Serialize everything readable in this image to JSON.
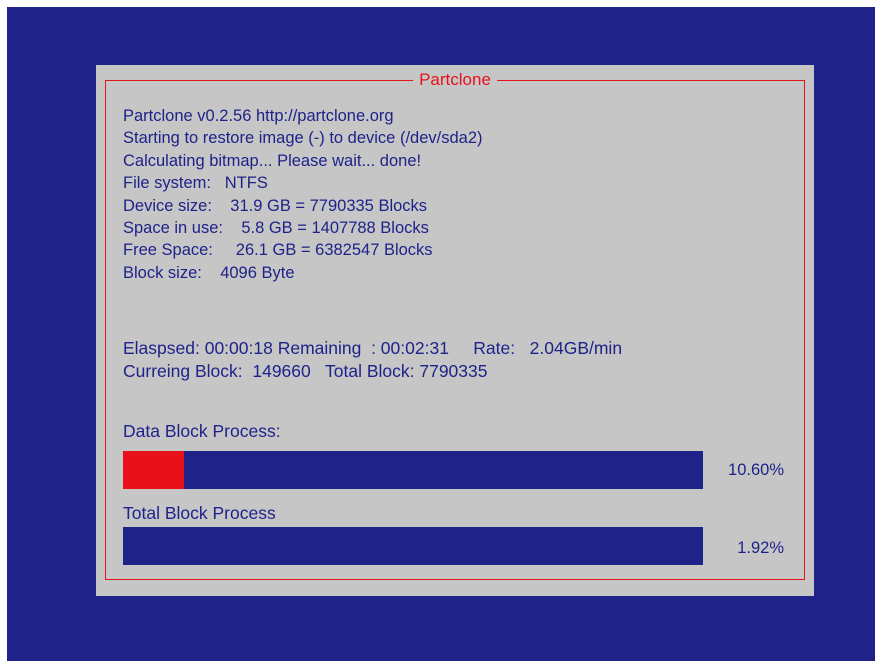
{
  "dialog": {
    "title": "Partclone"
  },
  "info": {
    "lines": [
      "Partclone v0.2.56 http://partclone.org",
      "Starting to restore image (-) to device (/dev/sda2)",
      "Calculating bitmap... Please wait... done!",
      "File system:   NTFS",
      "Device size:    31.9 GB = 7790335 Blocks",
      "Space in use:    5.8 GB = 1407788 Blocks",
      "Free Space:     26.1 GB = 6382547 Blocks",
      "Block size:    4096 Byte"
    ]
  },
  "status": {
    "line1": "Elaspsed: 00:00:18 Remaining  : 00:02:31     Rate:   2.04GB/min",
    "line2": "Curreing Block:  149660   Total Block: 7790335"
  },
  "data_block": {
    "label": "Data Block Process:",
    "percent_text": "10.60%",
    "progress": 0.106
  },
  "total_block": {
    "label": "Total Block Process",
    "percent_text": "1.92%",
    "progress": 0.0192
  },
  "colors": {
    "background": "#1f2289",
    "panel": "#c6c6c6",
    "accent": "#e3141c",
    "text": "#1f2289"
  }
}
